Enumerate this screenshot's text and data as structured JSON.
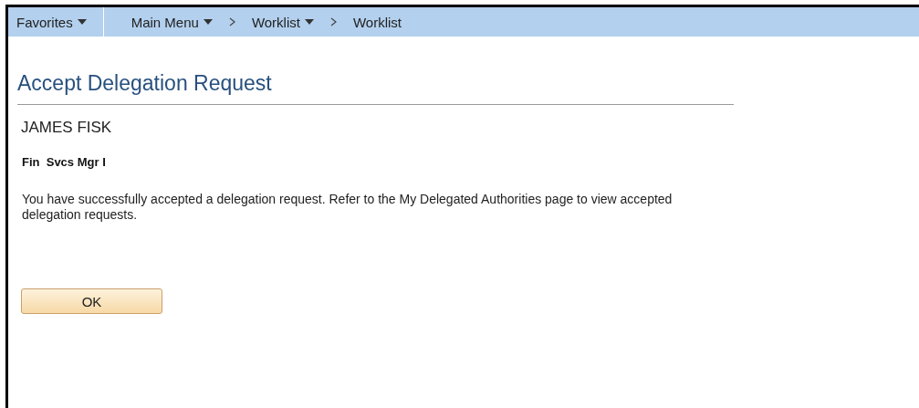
{
  "nav_bar": {
    "items": [
      {
        "label": "Favorites",
        "kind": "menu"
      },
      {
        "label": "Main Menu",
        "kind": "menu"
      },
      {
        "label": "Worklist",
        "kind": "menu"
      },
      {
        "label": "Worklist",
        "kind": "link"
      }
    ]
  },
  "page": {
    "title": "Accept Delegation Request",
    "name": "JAMES FISK",
    "role": "Fin  Svcs Mgr I",
    "message": "You have successfully accepted a delegation request. Refer to the My Delegated Authorities page to view accepted delegation requests.",
    "button": "OK"
  }
}
